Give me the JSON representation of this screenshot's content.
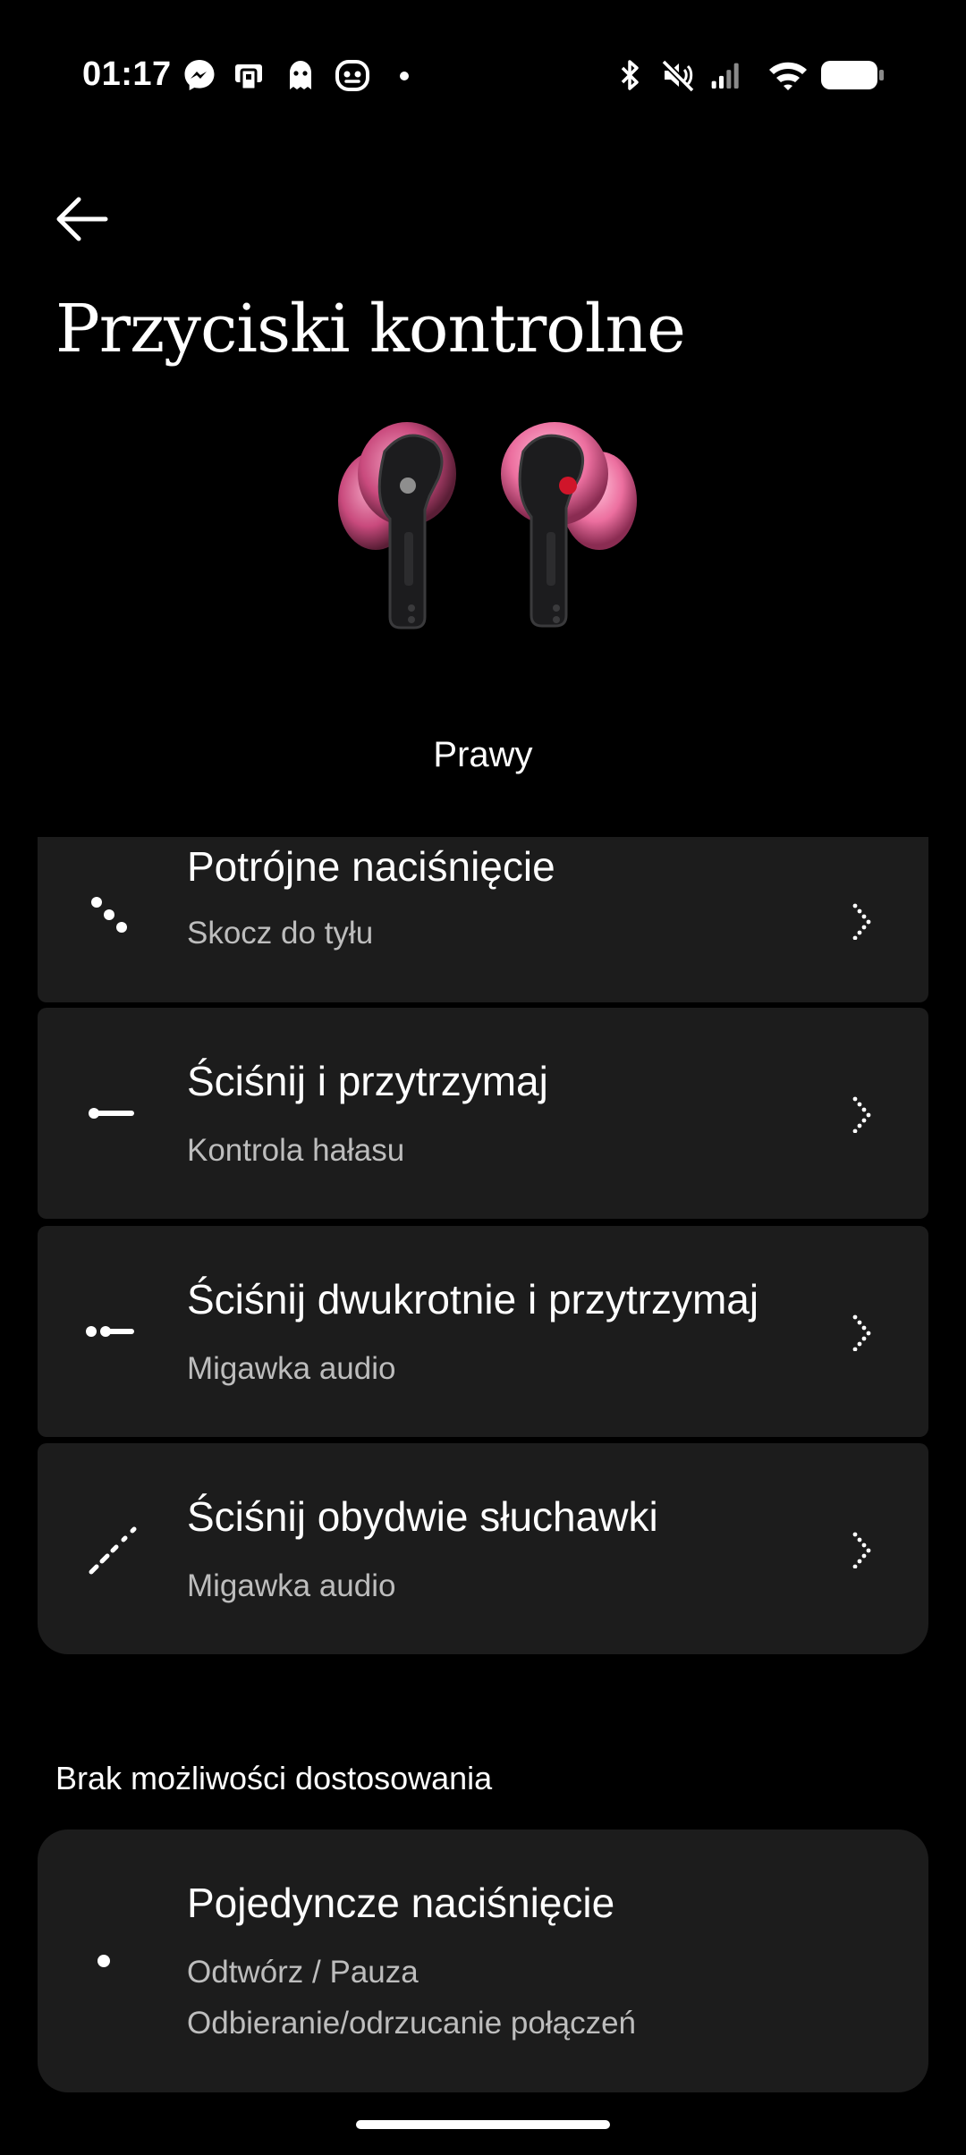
{
  "status_bar": {
    "time": "01:17",
    "left_icons": [
      "messenger-icon",
      "app-notification-icon",
      "ghost-icon",
      "bot-face-icon"
    ],
    "right_icons": [
      "bluetooth-icon",
      "mute-icon",
      "signal-icon",
      "wifi-icon",
      "battery-icon"
    ]
  },
  "header": {
    "back_icon": "arrow-left-icon",
    "title": "Przyciski kontrolne"
  },
  "device": {
    "side_label": "Prawy"
  },
  "controls": [
    {
      "icon": "triple-press-icon",
      "title": "Potrójne naciśnięcie",
      "subtitle": "Skocz do tyłu"
    },
    {
      "icon": "squeeze-hold-icon",
      "title": "Ściśnij i przytrzymaj",
      "subtitle": "Kontrola hałasu"
    },
    {
      "icon": "double-squeeze-hold-icon",
      "title": "Ściśnij dwukrotnie i przytrzymaj",
      "subtitle": "Migawka audio"
    },
    {
      "icon": "squeeze-both-icon",
      "title": "Ściśnij obydwie słuchawki",
      "subtitle": "Migawka audio"
    }
  ],
  "non_customizable": {
    "section_label": "Brak możliwości dostosowania",
    "item": {
      "icon": "single-press-icon",
      "title": "Pojedyncze naciśnięcie",
      "subtitle_1": "Odtwórz / Pauza",
      "subtitle_2": "Odbieranie/odrzucanie połączeń"
    }
  },
  "colors": {
    "background": "#000000",
    "card": "#1c1c1c",
    "accent_red": "#d0152a",
    "bud_pink": "#e85a8e"
  }
}
